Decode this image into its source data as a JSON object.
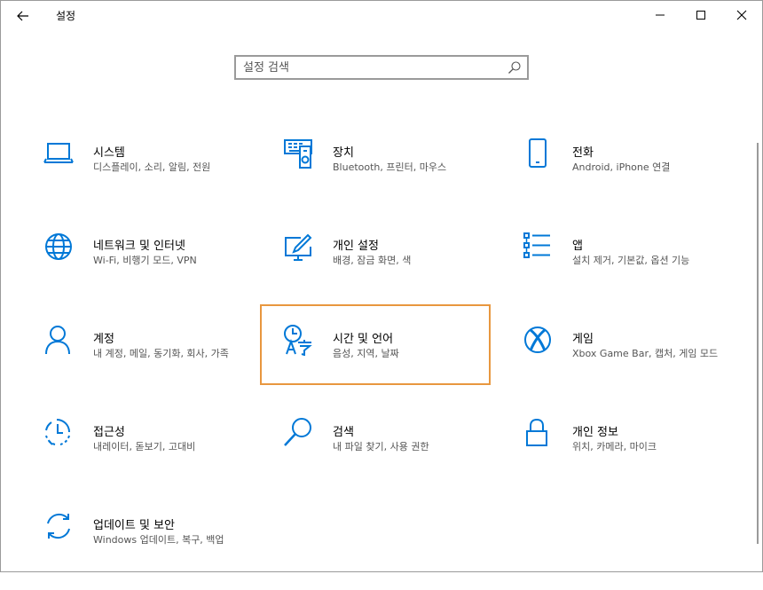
{
  "window": {
    "title": "설정"
  },
  "search": {
    "placeholder": "설정 검색"
  },
  "tiles": [
    {
      "title": "시스템",
      "desc": "디스플레이, 소리, 알림, 전원",
      "icon": "laptop-icon"
    },
    {
      "title": "장치",
      "desc": "Bluetooth, 프린터, 마우스",
      "icon": "devices-icon"
    },
    {
      "title": "전화",
      "desc": "Android, iPhone 연결",
      "icon": "phone-icon"
    },
    {
      "title": "네트워크 및 인터넷",
      "desc": "Wi-Fi, 비행기 모드, VPN",
      "icon": "globe-icon"
    },
    {
      "title": "개인 설정",
      "desc": "배경, 잠금 화면, 색",
      "icon": "personalization-icon"
    },
    {
      "title": "앱",
      "desc": "설치 제거, 기본값, 옵션 기능",
      "icon": "apps-list-icon"
    },
    {
      "title": "계정",
      "desc": "내 계정, 메일, 동기화, 회사, 가족",
      "icon": "person-icon"
    },
    {
      "title": "시간 및 언어",
      "desc": "음성, 지역, 날짜",
      "icon": "time-language-icon"
    },
    {
      "title": "게임",
      "desc": "Xbox Game Bar, 캡처, 게임 모드",
      "icon": "xbox-icon"
    },
    {
      "title": "접근성",
      "desc": "내레이터, 돋보기, 고대비",
      "icon": "ease-of-access-icon"
    },
    {
      "title": "검색",
      "desc": "내 파일 찾기, 사용 권한",
      "icon": "search-icon"
    },
    {
      "title": "개인 정보",
      "desc": "위치, 카메라, 마이크",
      "icon": "lock-icon"
    },
    {
      "title": "업데이트 및 보안",
      "desc": "Windows 업데이트, 복구, 백업",
      "icon": "sync-icon"
    }
  ],
  "colors": {
    "accent": "#0078d7",
    "selection_border": "#e8973f"
  }
}
